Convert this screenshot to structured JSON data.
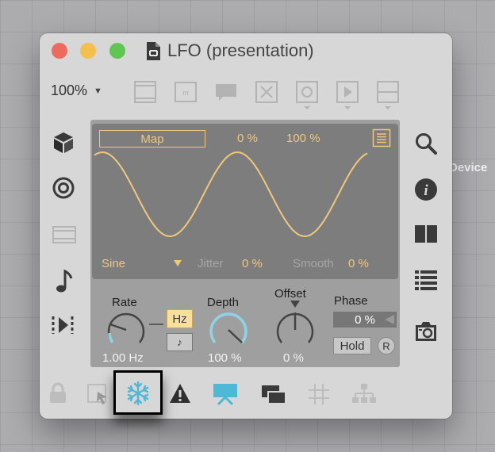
{
  "background": {
    "label": "Device"
  },
  "window": {
    "title": "LFO (presentation)"
  },
  "toolbar": {
    "zoom": "100%",
    "zoom_arrow": "▼"
  },
  "lfo": {
    "map_label": "Map",
    "amount_value": "0 %",
    "scale_value": "100 %",
    "waveform": "Sine",
    "jitter_label": "Jitter",
    "jitter_value": "0 %",
    "smooth_label": "Smooth",
    "smooth_value": "0 %",
    "rate_label": "Rate",
    "rate_value": "1.00 Hz",
    "rate_unit_hz": "Hz",
    "rate_unit_sync": "♪",
    "depth_label": "Depth",
    "depth_value": "100 %",
    "offset_label": "Offset",
    "offset_value": "0 %",
    "phase_label": "Phase",
    "phase_value": "0 %",
    "hold_label": "Hold",
    "retrigger_label": "R"
  },
  "colors": {
    "accent_amber": "#f0c87c",
    "accent_blue": "#4fb8d6",
    "display_bg": "#7d7d7d",
    "window_bg": "#d7d7d7"
  }
}
